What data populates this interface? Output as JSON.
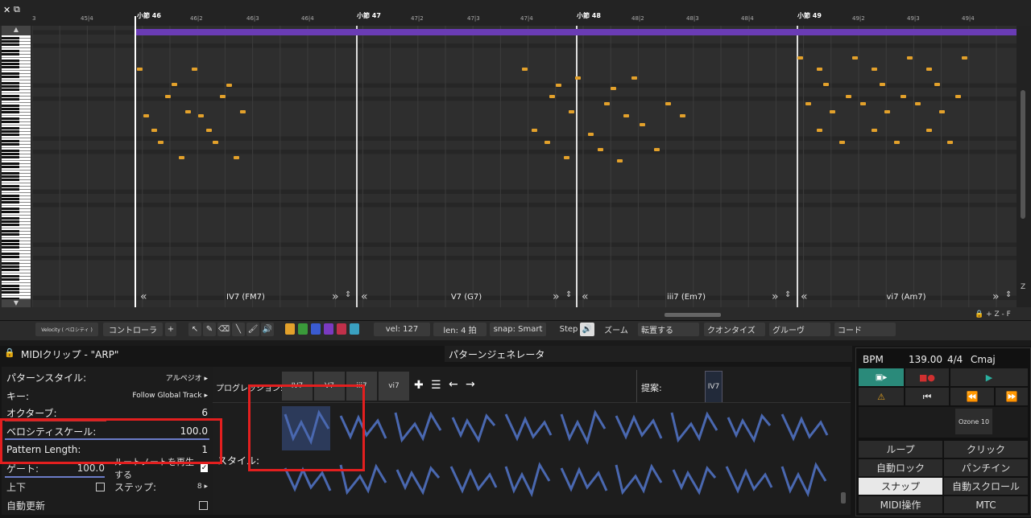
{
  "window": {
    "close_glyph": "✕",
    "restore_glyph": "⧉"
  },
  "ruler": {
    "ticks": [
      "3",
      "45|4",
      "46|2",
      "46|3",
      "46|4",
      "47|2",
      "47|3",
      "47|4",
      "48|2",
      "48|3",
      "48|4",
      "49|2",
      "49|3",
      "49|4"
    ],
    "bars": [
      "小節 46",
      "小節 47",
      "小節 48",
      "小節 49"
    ]
  },
  "chords": [
    "IV7 (FM7)",
    "V7 (G7)",
    "iii7 (Em7)",
    "vi7 (Am7)"
  ],
  "roll_right": {
    "zoom_plus": "+",
    "zoom_z": "Z",
    "zoom_minus": "-",
    "f_label": "F",
    "bottom_row": "🔒 + Z - F"
  },
  "toolbar": {
    "velocity": "Velocity ( ベロシティ )",
    "controller": "コントローラ",
    "add": "+",
    "vel": "vel: 127",
    "len": "len: 4 拍",
    "snap": "snap: Smart",
    "step": "Step",
    "zoom": "ズーム",
    "transpose": "転置する",
    "quantize": "クオンタイズ",
    "groove": "グルーヴ",
    "chord": "コード",
    "colors": [
      "#e3a12b",
      "#3a9a3a",
      "#3a5bd0",
      "#7a3ac0",
      "#c0304a",
      "#3aa0c0"
    ]
  },
  "midi_clip": {
    "title": "MIDIクリップ - \"ARP\""
  },
  "params": {
    "style_label": "パターンスタイル:",
    "style_value": "アルペジオ",
    "key_label": "キー:",
    "key_value": "Follow Global Track",
    "octave_label": "オクターブ:",
    "octave_value": "6",
    "velscale_label": "ベロシティスケール:",
    "velscale_value": "100.0",
    "patlen_label": "Pattern Length:",
    "patlen_value": "1",
    "gate_label": "ゲート:",
    "gate_value": "100.0",
    "root_label": "ルートノートを再生する",
    "updown_label": "上下",
    "steps_label": "ステップ:",
    "steps_value": "8",
    "autoupdate_label": "自動更新"
  },
  "generator": {
    "title": "パターンジェネレータ",
    "progression_label": "プログレッション:",
    "progression": [
      "IV7",
      "V7",
      "iii7",
      "vi7"
    ],
    "suggest_label": "提案:",
    "suggest": [
      "IV7"
    ],
    "style_label": "スタイル:"
  },
  "transport": {
    "bpm_label": "BPM",
    "bpm": "139.00",
    "sig": "4/4",
    "key": "Cmaj",
    "plugin": "Ozone 10",
    "loop": "ループ",
    "click": "クリック",
    "autolock": "自動ロック",
    "punchin": "パンチイン",
    "snap": "スナップ",
    "autoscroll": "自動スクロール",
    "midiop": "MIDI操作",
    "mtc": "MTC"
  }
}
